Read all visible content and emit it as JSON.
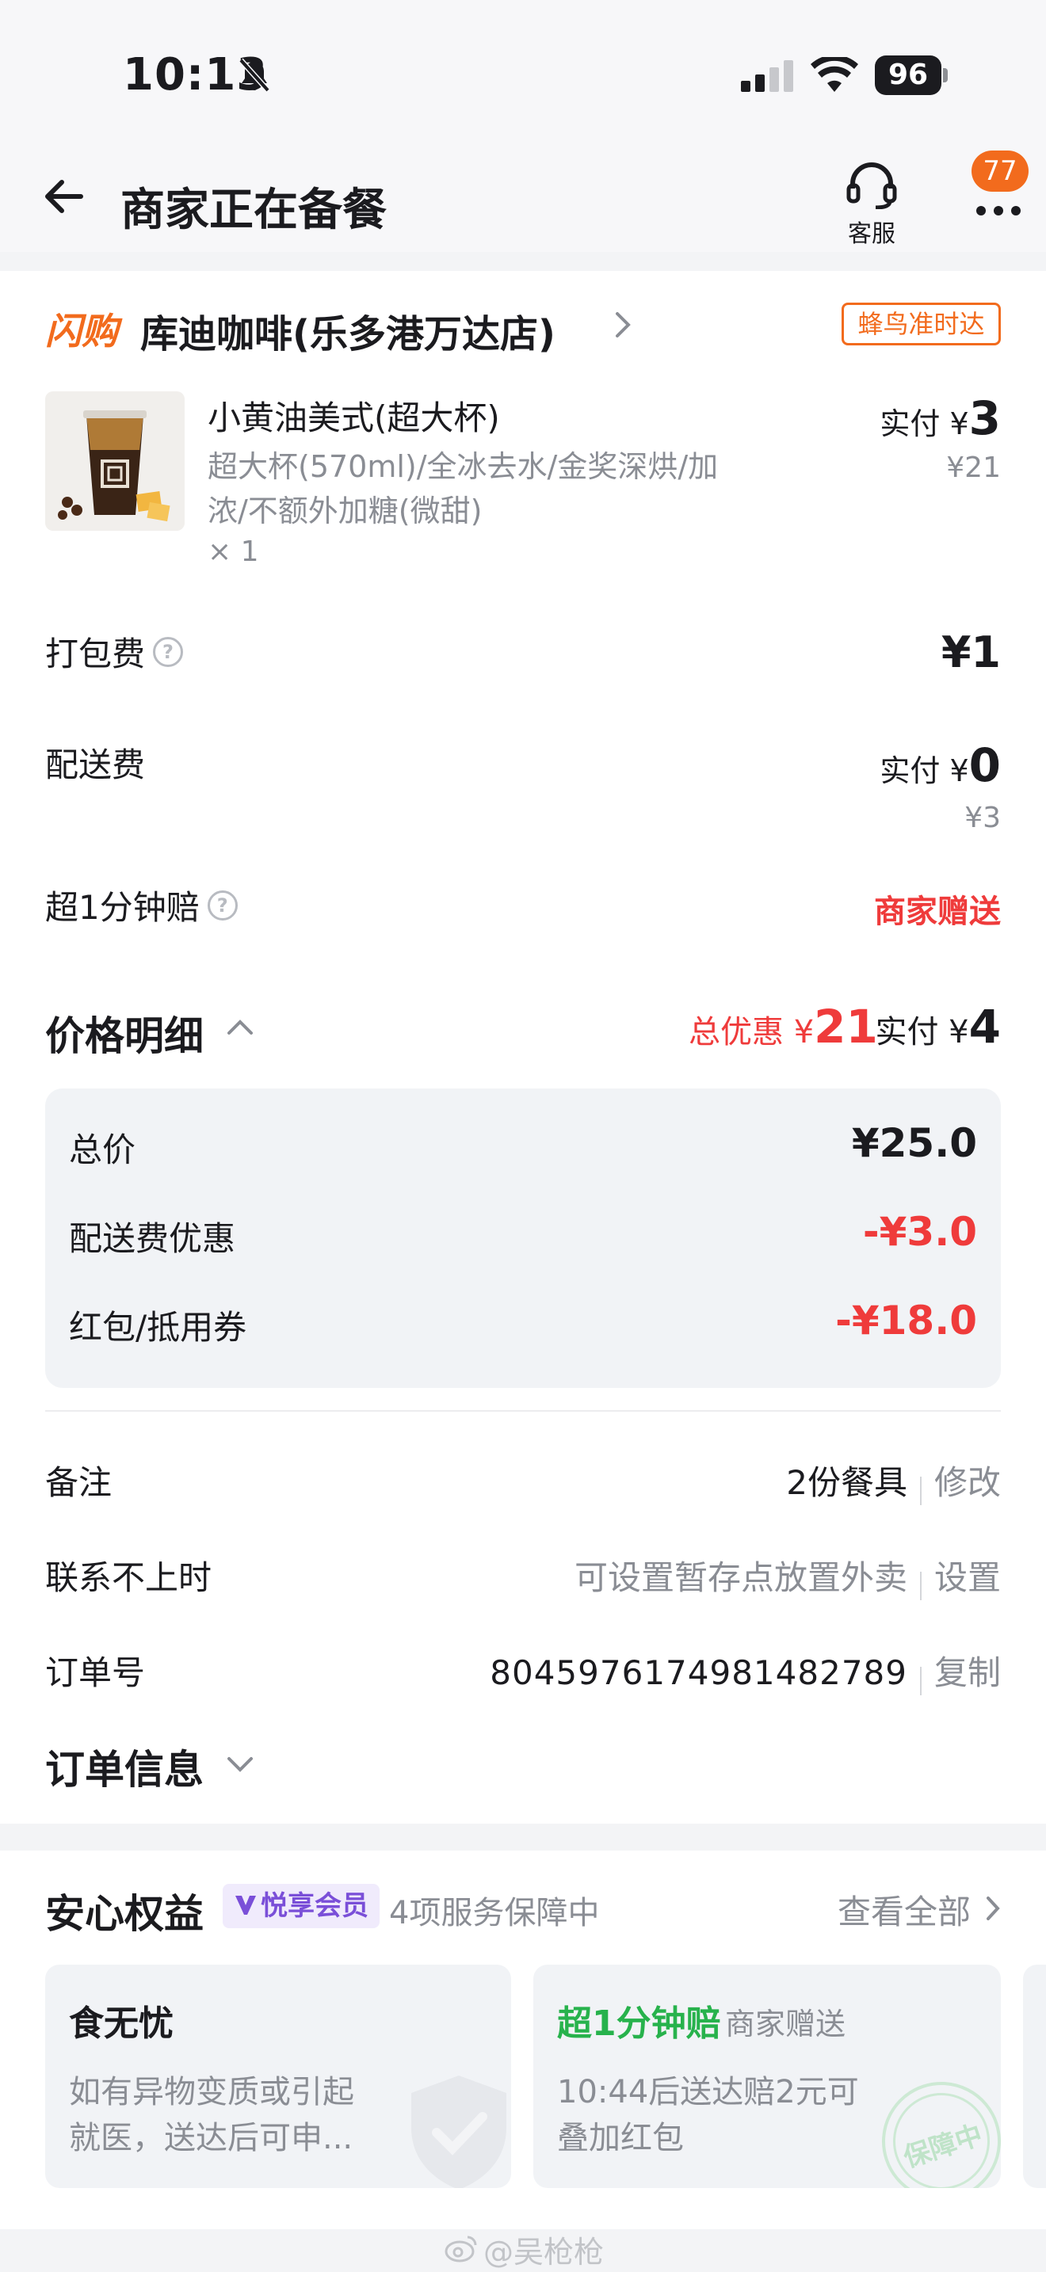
{
  "status_bar": {
    "time": "10:13",
    "battery": "96"
  },
  "header": {
    "title": "商家正在备餐",
    "service_label": "客服",
    "notification_count": "77"
  },
  "store": {
    "brand_tag": "闪购",
    "name": "库迪咖啡(乐多港万达店)",
    "delivery_badge": "蜂鸟准时达",
    "item": {
      "name": "小黄油美式(超大杯)",
      "spec_line1": "超大杯(570ml)/全冰去水/金奖深烘/加",
      "spec_line2": "浓/不额外加糖(微甜)",
      "quantity": "× 1",
      "paid_prefix": "实付 ¥",
      "paid_amount": "3",
      "original_price": "¥21"
    },
    "packing_fee": {
      "label": "打包费",
      "value": "¥1"
    },
    "delivery_fee": {
      "label": "配送费",
      "paid_prefix": "实付 ¥",
      "paid_amount": "0",
      "original_price": "¥3"
    },
    "late_compensation": {
      "label": "超1分钟赔",
      "value": "商家赠送"
    }
  },
  "price_detail": {
    "title": "价格明细",
    "total_discount_prefix": "总优惠 ¥",
    "total_discount": "21",
    "paid_prefix": "实付 ¥",
    "paid_amount": "4",
    "rows": [
      {
        "label": "总价",
        "value": "¥25.0"
      },
      {
        "label": "配送费优惠",
        "value": "-¥3.0"
      },
      {
        "label": "红包/抵用券",
        "value": "-¥18.0"
      }
    ]
  },
  "order_info": {
    "remark": {
      "label": "备注",
      "value": "2份餐具",
      "action": "修改"
    },
    "unreachable": {
      "label": "联系不上时",
      "value": "可设置暂存点放置外卖",
      "action": "设置"
    },
    "order_no": {
      "label": "订单号",
      "value": "8045976174981482789",
      "action": "复制"
    },
    "title": "订单信息"
  },
  "assurance": {
    "title": "安心权益",
    "member_badge": "悦享会员",
    "subtitle": "4项服务保障中",
    "view_all": "查看全部",
    "cards": [
      {
        "title": "食无忧",
        "desc_line1": "如有异物变质或引起",
        "desc_line2": "就医，送达后可申..."
      },
      {
        "title": "超1分钟赔",
        "tag": "商家赠送",
        "desc_line1": "10:44后送达赔2元可",
        "desc_line2": "叠加红包",
        "stamp": "保障中"
      }
    ]
  },
  "watermark": "@吴枪枪",
  "colors": {
    "brand_orange": "#f26b1d",
    "discount_red": "#ef3b3b",
    "assurance_green": "#27b24c",
    "member_purple": "#7a4fd8"
  }
}
